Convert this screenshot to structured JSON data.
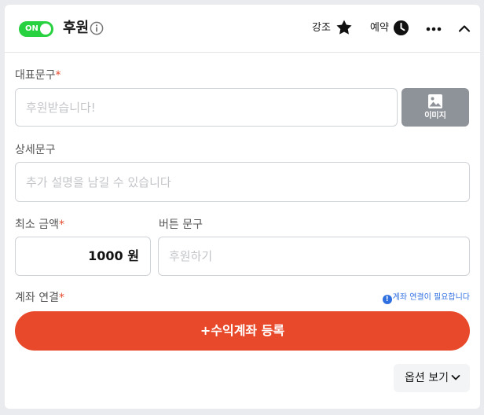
{
  "header": {
    "toggle_label": "ON",
    "title": "후원",
    "highlight_label": "강조",
    "schedule_label": "예약"
  },
  "headline": {
    "label": "대표문구",
    "required_mark": "*",
    "placeholder": "후원받습니다!",
    "image_button_label": "이미지"
  },
  "detail": {
    "label": "상세문구",
    "placeholder": "추가 설명을 남길 수 있습니다"
  },
  "min_amount": {
    "label": "최소 금액",
    "required_mark": "*",
    "value": "1000",
    "unit": "원"
  },
  "button_text": {
    "label": "버튼 문구",
    "placeholder": "후원하기"
  },
  "account": {
    "label": "계좌 연결",
    "required_mark": "*",
    "hint_icon": "!",
    "hint": "계좌 연결이 필요합니다",
    "register_button": "+수익계좌 등록"
  },
  "options_button": "옵션 보기",
  "colors": {
    "toggle_on": "#27d13f",
    "accent": "#e8492a",
    "hint": "#2f6fe0",
    "image_button": "#8e9299"
  }
}
